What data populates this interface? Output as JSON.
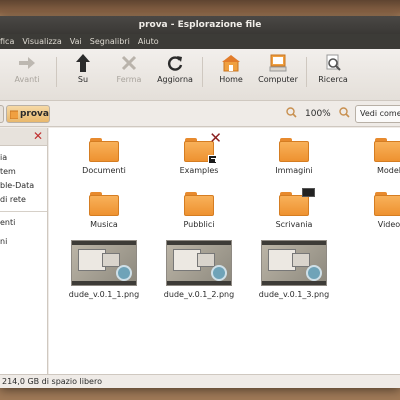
{
  "window": {
    "title": "prova - Esplorazione file"
  },
  "menu": [
    "fica",
    "Visualizza",
    "Vai",
    "Segnalibri",
    "Aiuto"
  ],
  "toolbar": {
    "back": "Avanti",
    "up": "Su",
    "stop": "Ferma",
    "reload": "Aggiorna",
    "home": "Home",
    "computer": "Computer",
    "search": "Ricerca"
  },
  "location": {
    "crumb": "prova",
    "zoom": "100%",
    "view_select": "Vedi come"
  },
  "sidebar": {
    "items": [
      "ia",
      "tem",
      "ble-Data",
      "di rete"
    ],
    "items2": [
      "enti",
      "ni"
    ]
  },
  "files": [
    {
      "name": "Documenti",
      "type": "folder"
    },
    {
      "name": "Examples",
      "type": "folder"
    },
    {
      "name": "Immagini",
      "type": "folder"
    },
    {
      "name": "Model",
      "type": "folder"
    },
    {
      "name": "Musica",
      "type": "folder"
    },
    {
      "name": "Pubblici",
      "type": "folder"
    },
    {
      "name": "Scrivania",
      "type": "folder"
    },
    {
      "name": "Video",
      "type": "folder"
    },
    {
      "name": "dude_v.0.1_1.png",
      "type": "image"
    },
    {
      "name": "dude_v.0.1_2.png",
      "type": "image"
    },
    {
      "name": "dude_v.0.1_3.png",
      "type": "image"
    }
  ],
  "status": "214,0 GB di spazio libero",
  "colors": {
    "folder": "#f0a040",
    "titlebar": "#3c3b37",
    "close_x": "#c03030"
  }
}
